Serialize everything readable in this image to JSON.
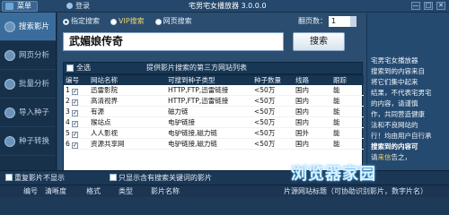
{
  "titlebar": {
    "menu_label": "菜单",
    "login_label": "登录",
    "app_title": "宅男宅女播放器 3.0.0.0",
    "controls": [
      "—",
      "□",
      "✕"
    ]
  },
  "sidebar": {
    "items": [
      {
        "label": "搜索影片",
        "icon": "search-icon"
      },
      {
        "label": "网页分析",
        "icon": "web-icon"
      },
      {
        "label": "批量分析",
        "icon": "batch-icon"
      },
      {
        "label": "导入种子",
        "icon": "import-icon"
      },
      {
        "label": "种子转换",
        "icon": "convert-icon"
      }
    ]
  },
  "search": {
    "modes": [
      {
        "label": "指定搜索",
        "selected": true
      },
      {
        "label": "VIP搜索",
        "selected": false
      },
      {
        "label": "网页搜索",
        "selected": false
      }
    ],
    "pages_label": "翻页数：",
    "pages_value": "1",
    "query": "武媚娘传奇",
    "button_label": "搜索"
  },
  "site_panel": {
    "select_all_label": "全选",
    "caption": "提供影片搜索的第三方网站列表",
    "columns": [
      "编号",
      "网站名称",
      "可搜到种子类型",
      "种子数量",
      "线路",
      "跟踪"
    ],
    "rows": [
      {
        "no": "1",
        "name": "迅雷影院",
        "types": "HTTP,FTP,迅雷链接",
        "count": "<50万",
        "route": "国内",
        "track": "能"
      },
      {
        "no": "2",
        "name": "高清视界",
        "types": "HTTP,FTP,迅雷链接",
        "count": "<50万",
        "route": "国内",
        "track": "能"
      },
      {
        "no": "3",
        "name": "有源",
        "types": "磁力链",
        "count": "<50万",
        "route": "国内",
        "track": "能"
      },
      {
        "no": "4",
        "name": "猴站点",
        "types": "电驴链接",
        "count": "<50万",
        "route": "国内",
        "track": "能"
      },
      {
        "no": "5",
        "name": "人人影视",
        "types": "电驴链接,磁力链",
        "count": "<50万",
        "route": "国外",
        "track": "能"
      },
      {
        "no": "6",
        "name": "资源共享网",
        "types": "电驴链接,磁力链",
        "count": "<50万",
        "route": "国内",
        "track": "能"
      }
    ]
  },
  "right_info": {
    "lines": [
      "宅男宅女播放器",
      "搜索到的内容来自",
      "将它们集中起来",
      "结果，不代表宅男宅",
      "的内容，请谨慎",
      "作，共同营造健康",
      "法和不良网站的",
      "行！均由用户自行承"
    ],
    "tip": "搜索到的内容可",
    "tip_prefix": "请",
    "tip_link": "来信",
    "tip_suffix": "告之，"
  },
  "options": {
    "dedupe_label": "重复影片不显示",
    "keyword_only_label": "只显示含有搜索关键词的影片"
  },
  "results": {
    "columns": [
      "编号",
      "清晰度",
      "格式",
      "类型",
      "影片名称"
    ],
    "source_note": "片源网站标题（可协助识别影片，数字片名）"
  },
  "watermark": "浏览器家园"
}
